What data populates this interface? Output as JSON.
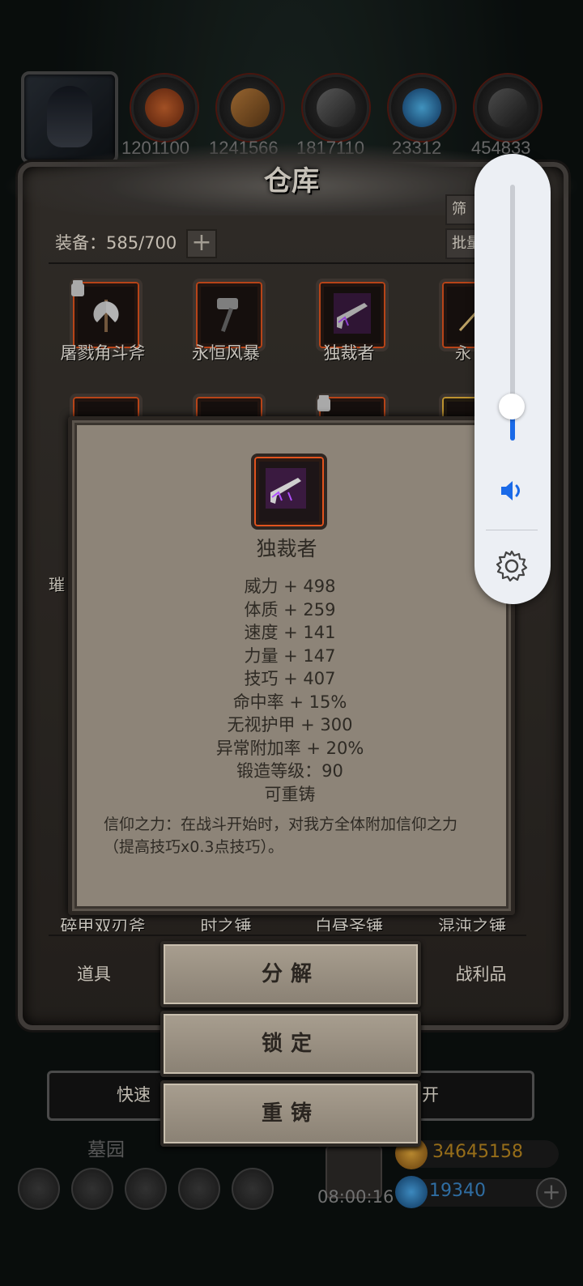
{
  "resources": [
    "1201100",
    "1241566",
    "1817110",
    "23312",
    "454833"
  ],
  "warehouse": {
    "title": "仓库",
    "equip_count": "装备：585/700",
    "expand_symbol": "+",
    "top_right_btn_1": "筛",
    "top_right_btn_2": "批量"
  },
  "items_row1": [
    "屠戮角斗斧",
    "永恒风暴",
    "独裁者",
    "永"
  ],
  "items_bottom_row": [
    "碎甲双刃斧",
    "时之锤",
    "白昼圣锤",
    "混沌之锤"
  ],
  "partial_labels": {
    "left_a": "璀"
  },
  "tabs": {
    "props": "道具",
    "loot": "战利品"
  },
  "bottom_bar": {
    "left_text": "快速",
    "right_text": "离开"
  },
  "area_label": "墓园",
  "timer": "08:00:16",
  "currency": {
    "gold": "34645158",
    "gems": "19340"
  },
  "tooltip": {
    "name": "独裁者",
    "stats": [
      "威力 + 498",
      "体质 + 259",
      "速度 + 141",
      "力量 + 147",
      "技巧 + 407",
      "命中率 + 15%",
      "无视护甲 + 300",
      "异常附加率 + 20%",
      "锻造等级：90",
      "可重铸"
    ],
    "description": "信仰之力：在战斗开始时，对我方全体附加信仰之力（提高技巧x0.3点技巧）。"
  },
  "actions": {
    "decompose": "分解",
    "lock": "锁定",
    "reforge": "重铸"
  },
  "volume": {
    "level_fraction": 0.13,
    "accent": "#1a6ae8"
  }
}
